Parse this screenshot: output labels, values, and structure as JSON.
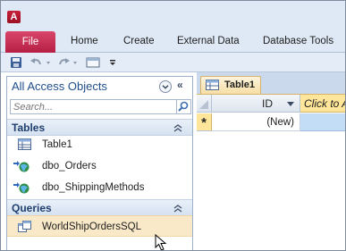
{
  "app": {
    "logo_letter": "A"
  },
  "ribbon": {
    "file_tab": "File",
    "tabs": [
      "Home",
      "Create",
      "External Data",
      "Database Tools"
    ]
  },
  "quick_access": {
    "icons": [
      "save-icon",
      "undo-icon",
      "redo-icon",
      "view-icon",
      "customize-icon"
    ]
  },
  "nav_pane": {
    "title": "All Access Objects",
    "search_placeholder": "Search...",
    "groups": [
      {
        "label": "Tables",
        "items": [
          {
            "label": "Table1",
            "icon": "table-icon"
          },
          {
            "label": "dbo_Orders",
            "icon": "linked-table-icon"
          },
          {
            "label": "dbo_ShippingMethods",
            "icon": "linked-table-icon"
          }
        ]
      },
      {
        "label": "Queries",
        "items": [
          {
            "label": "WorldShipOrdersSQL",
            "icon": "query-icon",
            "selected": true
          }
        ]
      }
    ]
  },
  "document": {
    "tab_label": "Table1",
    "columns": [
      "ID",
      "Click to Add"
    ],
    "new_row_marker": "*",
    "new_row_value": "(New)"
  },
  "colors": {
    "file_tab": "#c8284f",
    "nav_title": "#1f4e8c",
    "selection": "#fae9c8",
    "datasheet_header_active": "#ffe69a"
  }
}
